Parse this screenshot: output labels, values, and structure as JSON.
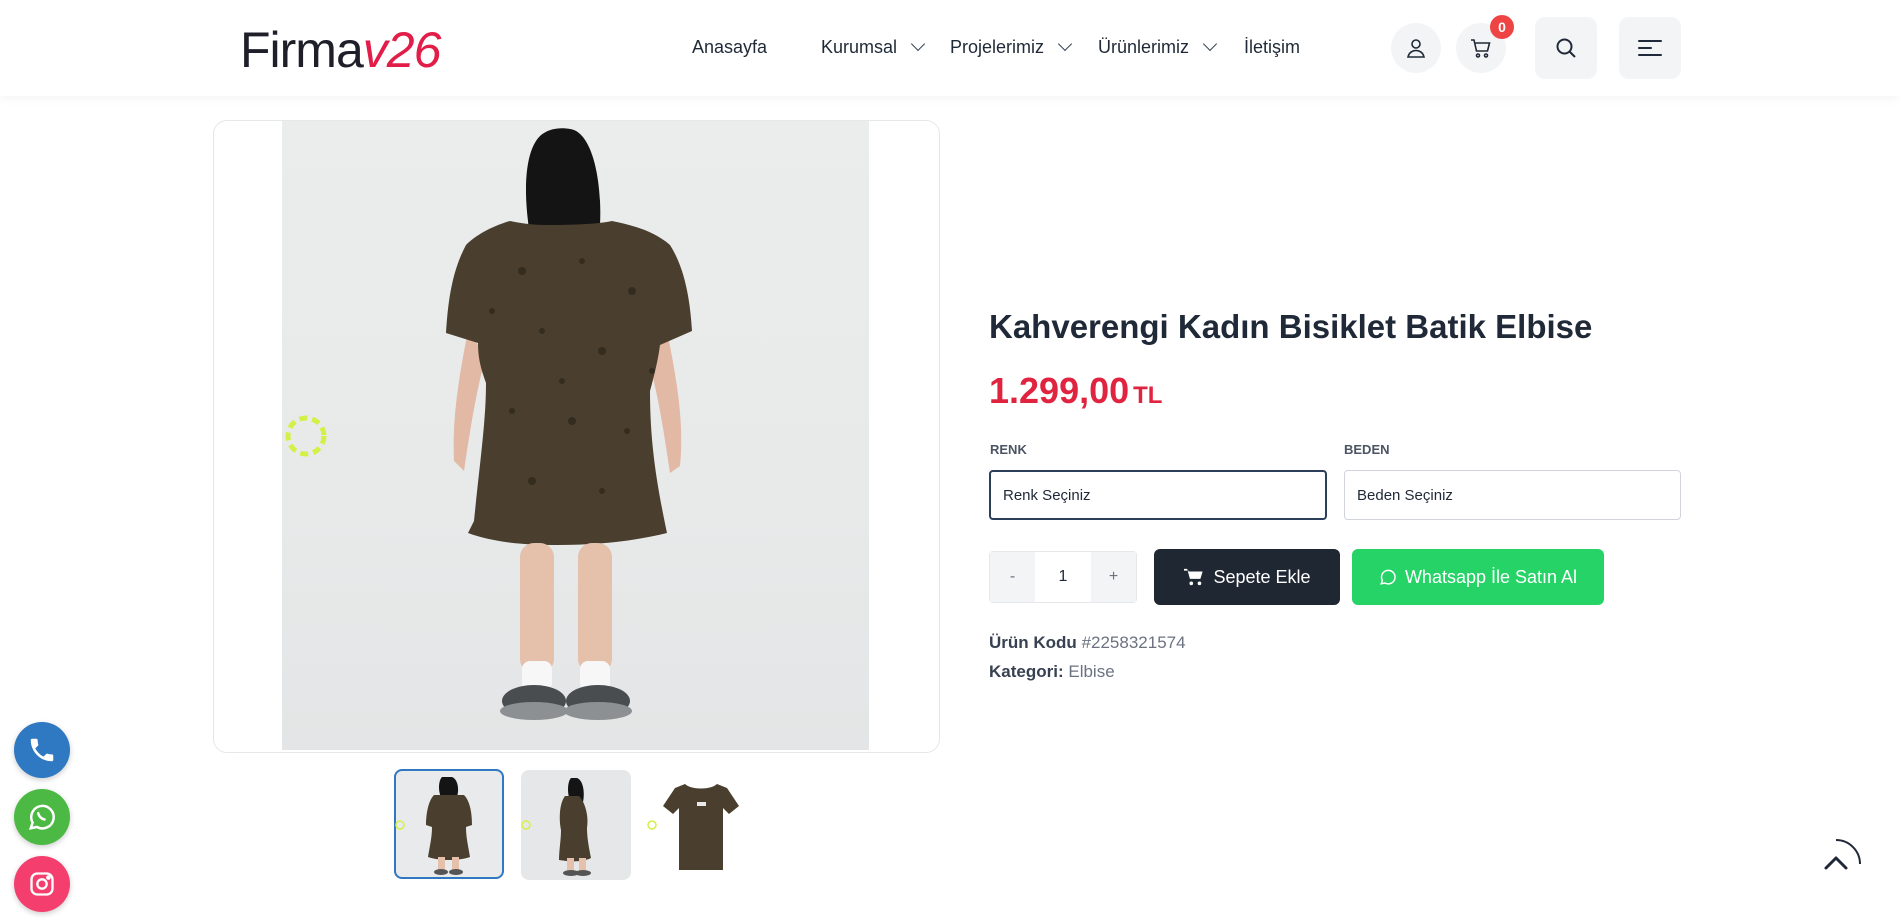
{
  "brand": {
    "part1": "Firma",
    "part2": "v26"
  },
  "nav": [
    {
      "label": "Anasayfa"
    },
    {
      "label": "Kurumsal"
    },
    {
      "label": "Projelerimiz"
    },
    {
      "label": "Ürünlerimiz"
    },
    {
      "label": "İletişim"
    }
  ],
  "header": {
    "cart_count": "0",
    "icons": [
      "user-icon",
      "cart-icon",
      "search-icon",
      "menu-icon"
    ]
  },
  "product": {
    "title": "Kahverengi Kadın Bisiklet Batik Elbise",
    "price": "1.299,00",
    "currency": "TL",
    "color_label": "RENK",
    "color_value": "Renk Seçiniz",
    "size_label": "BEDEN",
    "size_value": "Beden Seçiniz",
    "qty_minus": "-",
    "quantity": "1",
    "qty_plus": "+",
    "add_to_cart": "Sepete Ekle",
    "whatsapp_buy": "Whatsapp İle Satın Al",
    "code_label": "Ürün Kodu",
    "code_value": "#2258321574",
    "category_label": "Kategori:",
    "category_value": "Elbise"
  },
  "colors": {
    "accent": "#e0243f",
    "dark": "#1f2733",
    "whatsapp": "#25d366",
    "phone": "#2f78c2",
    "instagram": "#f43f6e",
    "dress": "#4a3f2e"
  },
  "floating": [
    "phone-icon",
    "whatsapp-icon",
    "instagram-icon"
  ],
  "thumbnails": 3
}
